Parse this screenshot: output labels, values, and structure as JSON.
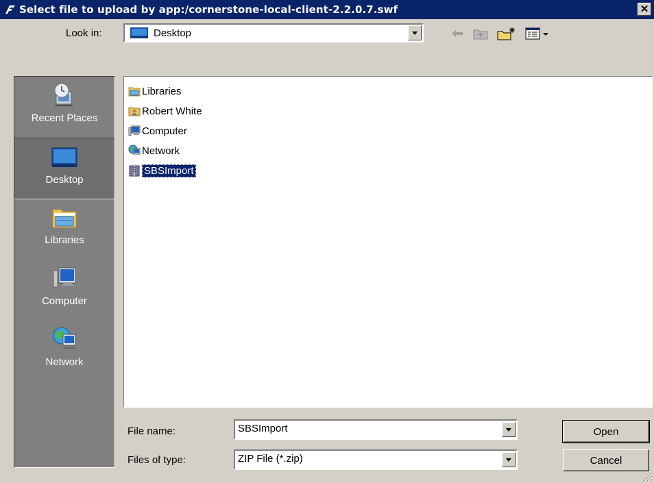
{
  "window": {
    "title": "Select file to upload by app:/cornerstone-local-client-2.2.0.7.swf",
    "close_glyph": "✕",
    "app_icon": "flash-icon"
  },
  "lookin": {
    "label": "Look in:",
    "value": "Desktop",
    "icon": "desktop-icon"
  },
  "toolbar": {
    "icons": [
      "back-arrow-icon",
      "up-folder-icon",
      "new-folder-icon",
      "view-menu-icon"
    ]
  },
  "places": [
    {
      "label": "Recent Places",
      "icon": "recent-places-icon"
    },
    {
      "label": "Desktop",
      "icon": "desktop-icon",
      "selected": true
    },
    {
      "label": "Libraries",
      "icon": "libraries-icon"
    },
    {
      "label": "Computer",
      "icon": "computer-icon"
    },
    {
      "label": "Network",
      "icon": "network-icon"
    }
  ],
  "files": [
    {
      "name": "Libraries",
      "icon": "libraries-icon"
    },
    {
      "name": "Robert White",
      "icon": "user-folder-icon"
    },
    {
      "name": "Computer",
      "icon": "computer-icon"
    },
    {
      "name": "Network",
      "icon": "network-icon"
    },
    {
      "name": "SBSImport",
      "icon": "zip-folder-icon",
      "selected": true
    }
  ],
  "filename": {
    "label": "File name:",
    "value": "SBSImport"
  },
  "filetype": {
    "label": "Files of type:",
    "value": "ZIP File (*.zip)"
  },
  "buttons": {
    "open": "Open",
    "cancel": "Cancel"
  }
}
